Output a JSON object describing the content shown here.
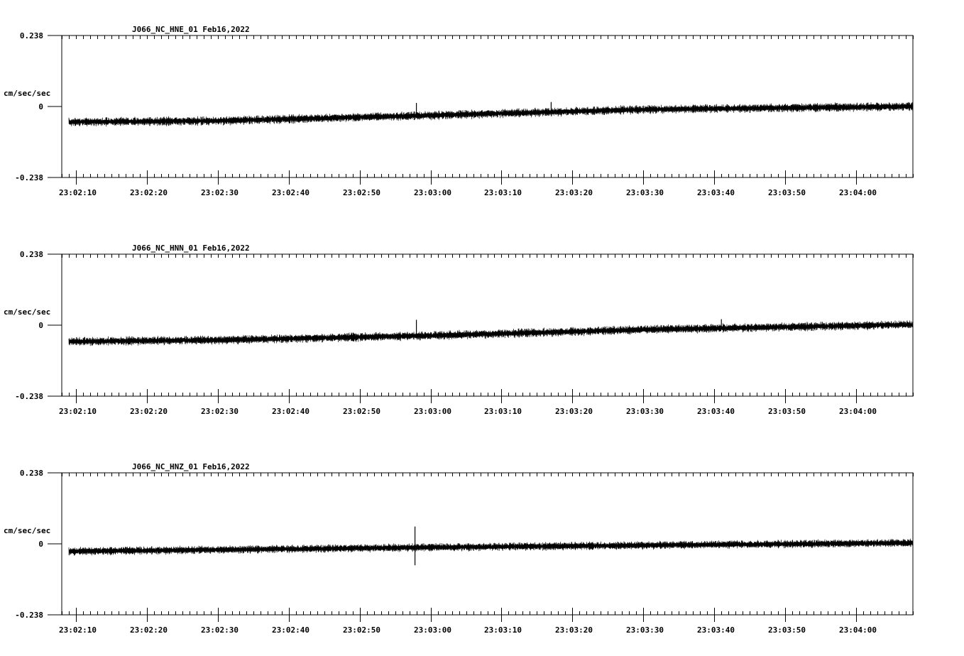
{
  "chart_data": [
    {
      "type": "line",
      "title": "J066_NC_HNE_01   Feb16,2022",
      "ylabel": "cm/sec/sec",
      "ylim": [
        -0.238,
        0.238
      ],
      "ytick_labels": [
        "0.238",
        "0",
        "-0.238"
      ],
      "xtick_labels": [
        "23:02:10",
        "23:02:20",
        "23:02:30",
        "23:02:40",
        "23:02:50",
        "23:03:00",
        "23:03:10",
        "23:03:20",
        "23:03:30",
        "23:03:40",
        "23:03:50",
        "23:04:00"
      ],
      "series": [
        {
          "start": "23:02:09",
          "end": "23:04:08",
          "trend_x": [
            "23:02:09",
            "23:02:30",
            "23:03:00",
            "23:03:30",
            "23:04:08"
          ],
          "trend_y": [
            -0.052,
            -0.048,
            -0.03,
            -0.01,
            0.0
          ],
          "noise_amplitude": 0.012,
          "spikes": [
            {
              "x": "23:02:58",
              "y": 0.012
            },
            {
              "x": "23:03:17",
              "y": 0.015
            }
          ]
        }
      ]
    },
    {
      "type": "line",
      "title": "J066_NC_HNN_01   Feb16,2022",
      "ylabel": "cm/sec/sec",
      "ylim": [
        -0.238,
        0.238
      ],
      "ytick_labels": [
        "0.238",
        "0",
        "-0.238"
      ],
      "xtick_labels": [
        "23:02:10",
        "23:02:20",
        "23:02:30",
        "23:02:40",
        "23:02:50",
        "23:03:00",
        "23:03:10",
        "23:03:20",
        "23:03:30",
        "23:03:40",
        "23:03:50",
        "23:04:00"
      ],
      "series": [
        {
          "start": "23:02:09",
          "end": "23:04:08",
          "trend_x": [
            "23:02:09",
            "23:02:30",
            "23:03:00",
            "23:03:30",
            "23:04:08"
          ],
          "trend_y": [
            -0.055,
            -0.05,
            -0.035,
            -0.015,
            0.002
          ],
          "noise_amplitude": 0.012,
          "spikes": [
            {
              "x": "23:02:58",
              "y": 0.018
            },
            {
              "x": "23:03:41",
              "y": 0.02
            }
          ]
        }
      ]
    },
    {
      "type": "line",
      "title": "J066_NC_HNZ_01   Feb16,2022",
      "ylabel": "cm/sec/sec",
      "ylim": [
        -0.238,
        0.238
      ],
      "ytick_labels": [
        "0.238",
        "0",
        "-0.238"
      ],
      "xtick_labels": [
        "23:02:10",
        "23:02:20",
        "23:02:30",
        "23:02:40",
        "23:02:50",
        "23:03:00",
        "23:03:10",
        "23:03:20",
        "23:03:30",
        "23:03:40",
        "23:03:50",
        "23:04:00"
      ],
      "series": [
        {
          "start": "23:02:09",
          "end": "23:04:08",
          "trend_x": [
            "23:02:09",
            "23:02:30",
            "23:03:00",
            "23:03:30",
            "23:04:08"
          ],
          "trend_y": [
            -0.025,
            -0.02,
            -0.012,
            -0.005,
            0.003
          ],
          "noise_amplitude": 0.011,
          "spikes": [
            {
              "x": "23:02:57.8",
              "y": 0.058
            },
            {
              "x": "23:02:57.8",
              "y": -0.072
            }
          ]
        }
      ]
    }
  ]
}
